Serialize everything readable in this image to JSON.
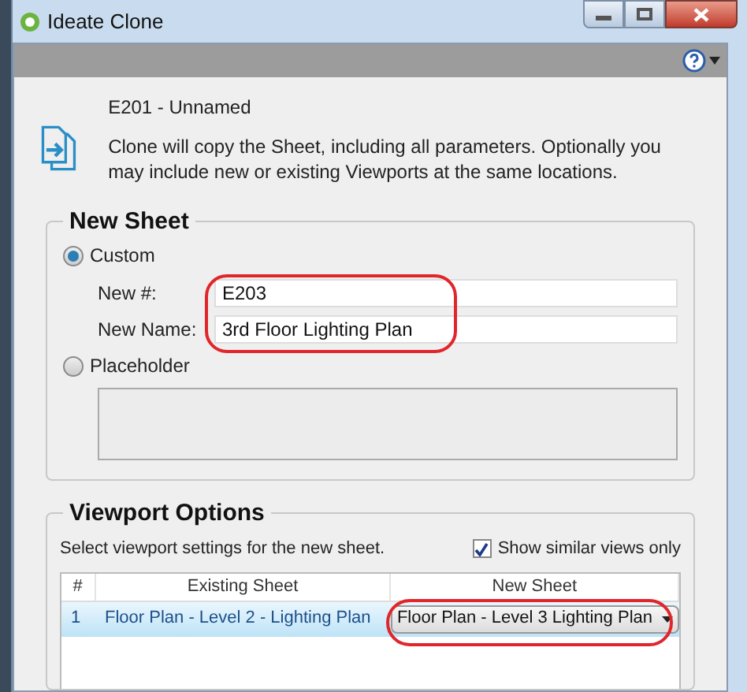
{
  "window": {
    "title": "Ideate Clone"
  },
  "header": {
    "sheet": "E201 - Unnamed",
    "description": "Clone will copy the Sheet, including all parameters. Optionally you may include new or existing Viewports at the same locations."
  },
  "new_sheet": {
    "title": "New Sheet",
    "options": [
      {
        "label": "Custom",
        "selected": true
      },
      {
        "label": "Placeholder",
        "selected": false
      }
    ],
    "fields": [
      {
        "label": "New #:",
        "value": "E203"
      },
      {
        "label": "New Name:",
        "value": "3rd Floor Lighting Plan"
      }
    ]
  },
  "viewport_options": {
    "title": "Viewport Options",
    "instruction": "Select viewport settings for the new sheet.",
    "show_similar": {
      "label": "Show similar views only",
      "checked": true
    },
    "table": {
      "columns": [
        "#",
        "Existing Sheet",
        "New Sheet"
      ],
      "rows": [
        {
          "number": "1",
          "existing_sheet": "Floor Plan - Level 2 - Lighting Plan",
          "new_sheet": "Floor Plan - Level 3 Lighting Plan",
          "selected": true
        }
      ]
    }
  }
}
